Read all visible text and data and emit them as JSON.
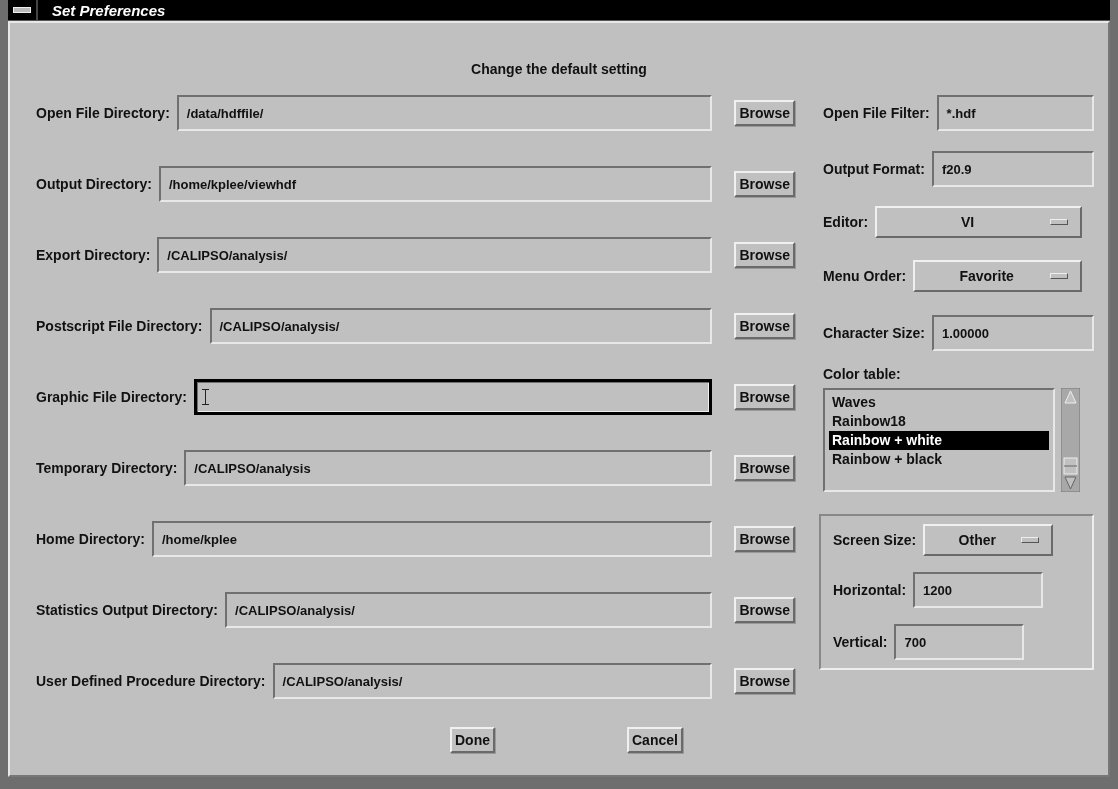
{
  "window": {
    "title": "Set Preferences"
  },
  "heading": "Change the default setting",
  "directories": [
    {
      "label": "Open File Directory:",
      "value": "/data/hdffile/",
      "focused": false,
      "button": "Browse"
    },
    {
      "label": "Output Directory:",
      "value": "/home/kplee/viewhdf",
      "focused": false,
      "button": "Browse"
    },
    {
      "label": "Export Directory:",
      "value": "/CALIPSO/analysis/",
      "focused": false,
      "button": "Browse"
    },
    {
      "label": "Postscript File Directory:",
      "value": "/CALIPSO/analysis/",
      "focused": false,
      "button": "Browse"
    },
    {
      "label": "Graphic File Directory:",
      "focused": true,
      "button": "Browse"
    },
    {
      "label": "Temporary Directory:",
      "value": "/CALIPSO/analysis",
      "focused": false,
      "button": "Browse"
    },
    {
      "label": "Home Directory:",
      "value": "/home/kplee",
      "focused": false,
      "button": "Browse"
    },
    {
      "label": "Statistics Output Directory:",
      "value": "/CALIPSO/analysis/",
      "focused": false,
      "button": "Browse"
    },
    {
      "label": "User Defined Procedure Directory:",
      "value": "/CALIPSO/analysis/",
      "focused": false,
      "button": "Browse"
    }
  ],
  "settings": [
    {
      "kind": "field",
      "label": "Open File Filter:",
      "value": "*.hdf"
    },
    {
      "kind": "field",
      "label": "Output Format:",
      "value": "f20.9"
    },
    {
      "kind": "menu",
      "label": "Editor:",
      "value": "VI"
    },
    {
      "kind": "menu",
      "label": "Menu Order:",
      "value": "Favorite"
    },
    {
      "kind": "field",
      "label": "Character Size:",
      "value": "1.00000"
    }
  ],
  "color_table": {
    "label": "Color table:",
    "items": [
      {
        "name": "Waves",
        "selected": false
      },
      {
        "name": "Rainbow18",
        "selected": false
      },
      {
        "name": "Rainbow + white",
        "selected": true
      },
      {
        "name": "Rainbow + black",
        "selected": false
      }
    ]
  },
  "screen": {
    "size_label": "Screen Size:",
    "size_value": "Other",
    "fields": [
      {
        "label": "Horizontal:",
        "value": "1200"
      },
      {
        "label": "Vertical:",
        "value": "700"
      }
    ]
  },
  "buttons": [
    "Done",
    "Cancel"
  ]
}
